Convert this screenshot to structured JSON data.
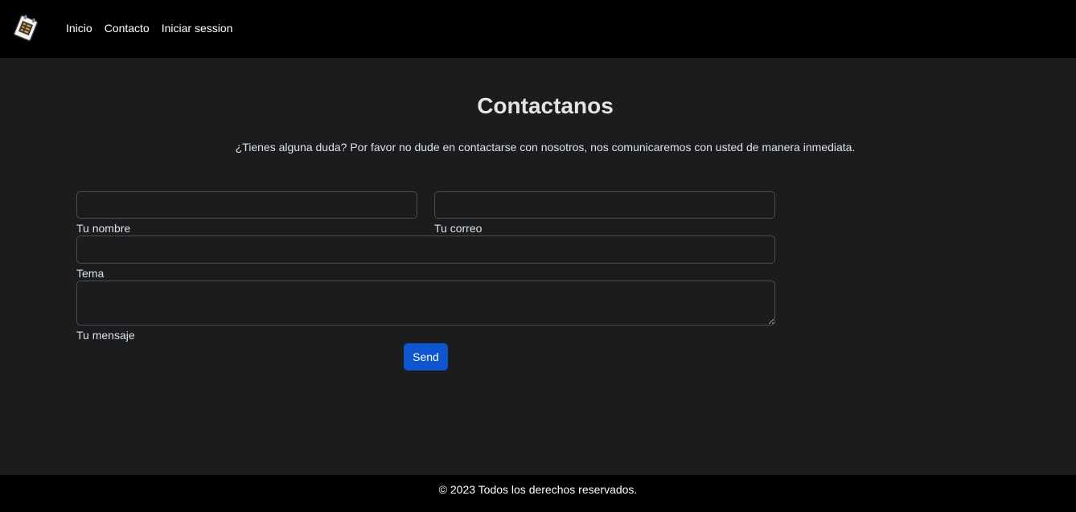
{
  "navbar": {
    "logo_icon": "notepad-logo-icon",
    "links": [
      {
        "label": "Inicio"
      },
      {
        "label": "Contacto"
      },
      {
        "label": "Iniciar session"
      }
    ]
  },
  "main": {
    "title": "Contactanos",
    "subtitle": "¿Tienes alguna duda? Por favor no dude en contactarse con nosotros, nos comunicaremos con usted de manera inmediata."
  },
  "form": {
    "name": {
      "label": "Tu nombre",
      "value": "",
      "placeholder": ""
    },
    "email": {
      "label": "Tu correo",
      "value": "",
      "placeholder": ""
    },
    "subject": {
      "label": "Tema",
      "value": "",
      "placeholder": ""
    },
    "message": {
      "label": "Tu mensaje",
      "value": "",
      "placeholder": ""
    },
    "send_label": "Send"
  },
  "footer": {
    "text": "© 2023 Todos los derechos reservados."
  },
  "colors": {
    "navbar_bg": "#000000",
    "page_bg": "#1b1c1e",
    "button_primary": "#0d56cf"
  }
}
